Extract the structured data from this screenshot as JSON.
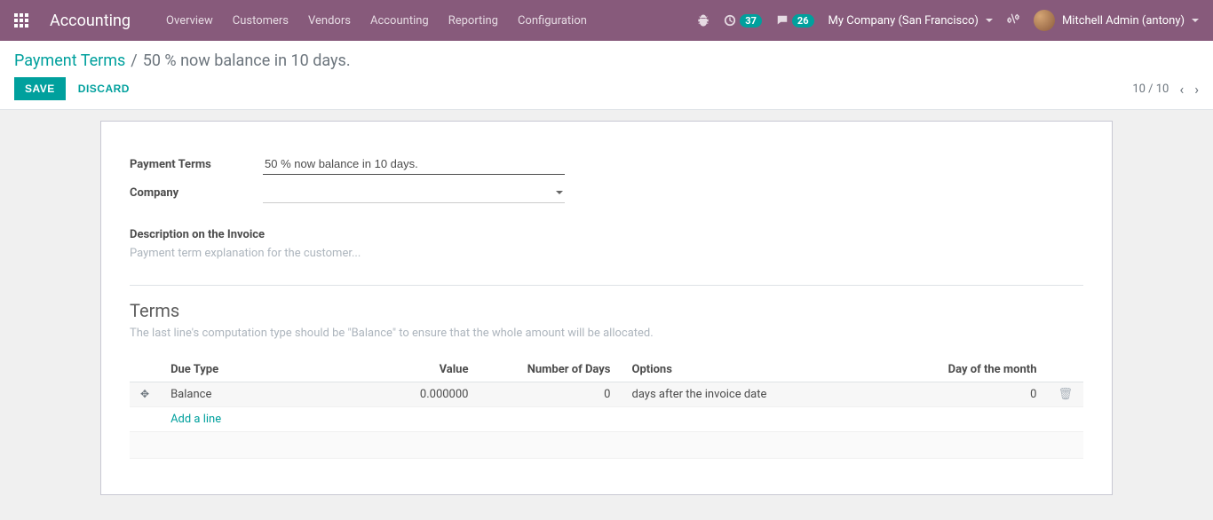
{
  "navbar": {
    "app_title": "Accounting",
    "menu": [
      "Overview",
      "Customers",
      "Vendors",
      "Accounting",
      "Reporting",
      "Configuration"
    ],
    "badge_cycle": "37",
    "badge_chat": "26",
    "company": "My Company (San Francisco)",
    "user": "Mitchell Admin (antony)"
  },
  "breadcrumb": {
    "parent": "Payment Terms",
    "current": "50 % now balance in 10 days."
  },
  "buttons": {
    "save": "SAVE",
    "discard": "DISCARD"
  },
  "pager": {
    "text": "10 / 10"
  },
  "form": {
    "payment_terms_label": "Payment Terms",
    "payment_terms_value": "50 % now balance in 10 days.",
    "company_label": "Company",
    "company_value": "",
    "desc_heading": "Description on the Invoice",
    "desc_placeholder": "Payment term explanation for the customer..."
  },
  "terms": {
    "title": "Terms",
    "hint": "The last line's computation type should be \"Balance\" to ensure that the whole amount will be allocated.",
    "columns": {
      "due_type": "Due Type",
      "value": "Value",
      "num_days": "Number of Days",
      "options": "Options",
      "day_of_month": "Day of the month"
    },
    "rows": [
      {
        "due_type": "Balance",
        "value": "0.000000",
        "num_days": "0",
        "options": "days after the invoice date",
        "day_of_month": "0"
      }
    ],
    "add_line": "Add a line"
  }
}
